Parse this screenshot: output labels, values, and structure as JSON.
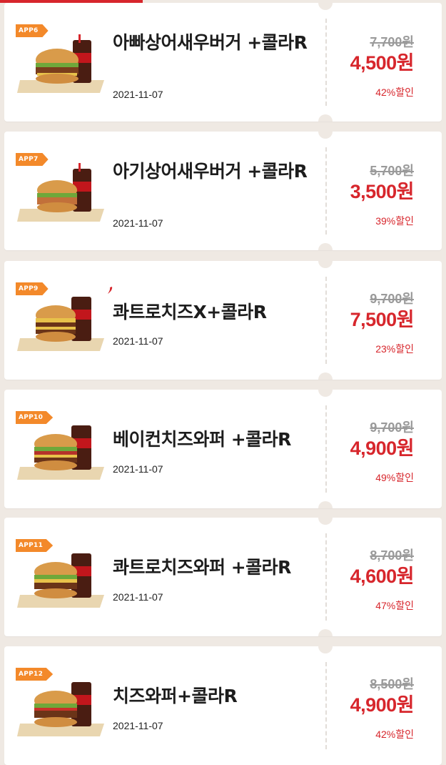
{
  "colors": {
    "accent": "#d7262c",
    "badge": "#f3892a",
    "background": "#efe9e3"
  },
  "coupons": [
    {
      "badge": "APP6",
      "title": "아빠상어새우버거 +콜라R",
      "date": "2021-11-07",
      "original_price": "7,700원",
      "sale_price": "4,500원",
      "discount": "42%할인",
      "image": "burger-cola-set-icon"
    },
    {
      "badge": "APP7",
      "title": "아기상어새우버거 +콜라R",
      "date": "2021-11-07",
      "original_price": "5,700원",
      "sale_price": "3,500원",
      "discount": "39%할인",
      "image": "burger-cola-set-icon"
    },
    {
      "badge": "APP9",
      "title": "콰트로치즈X+콜라R",
      "date": "2021-11-07",
      "original_price": "9,700원",
      "sale_price": "7,500원",
      "discount": "23%할인",
      "image": "burger-cola-set-icon"
    },
    {
      "badge": "APP10",
      "title": "베이컨치즈와퍼 +콜라R",
      "date": "2021-11-07",
      "original_price": "9,700원",
      "sale_price": "4,900원",
      "discount": "49%할인",
      "image": "burger-cola-set-icon"
    },
    {
      "badge": "APP11",
      "title": "콰트로치즈와퍼 +콜라R",
      "date": "2021-11-07",
      "original_price": "8,700원",
      "sale_price": "4,600원",
      "discount": "47%할인",
      "image": "burger-cola-set-icon"
    },
    {
      "badge": "APP12",
      "title": "치즈와퍼+콜라R",
      "date": "2021-11-07",
      "original_price": "8,500원",
      "sale_price": "4,900원",
      "discount": "42%할인",
      "image": "burger-cola-set-icon"
    }
  ]
}
